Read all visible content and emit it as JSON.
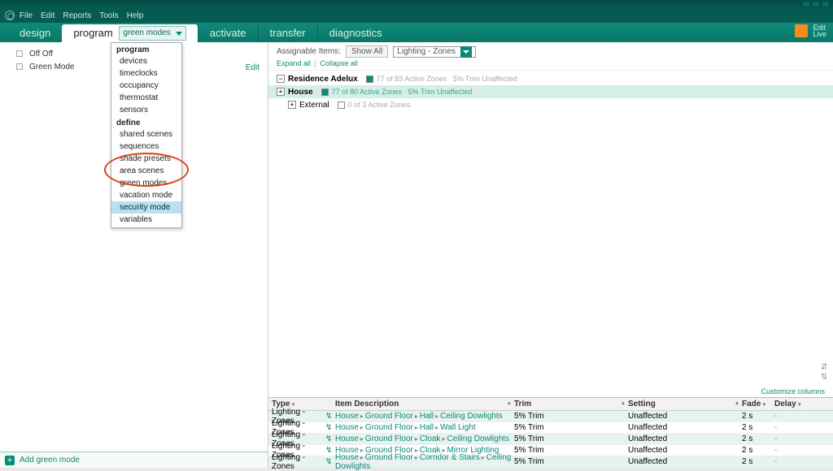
{
  "menubar": [
    "File",
    "Edit",
    "Reports",
    "Tools",
    "Help"
  ],
  "maintabs": {
    "design": "design",
    "program": "program",
    "activate": "activate",
    "transfer": "transfer",
    "diagnostics": "diagnostics"
  },
  "subcombo_label": "green modes",
  "right_header": {
    "edit": "Edit",
    "live": "Live"
  },
  "leftlist": {
    "row0": "Off  Off",
    "row1": "Green Mode",
    "edit": "Edit"
  },
  "leftfooter": {
    "add": "Add green mode"
  },
  "dropdown": {
    "grp_program": "program",
    "devices": "devices",
    "timeclocks": "timeclocks",
    "occupancy": "occupancy",
    "thermostat": "thermostat",
    "sensors": "sensors",
    "grp_define": "define",
    "shared_scenes": "shared scenes",
    "sequences": "sequences",
    "shade_presets": "shade presets",
    "area_scenes": "area scenes",
    "green_modes": "green modes",
    "vacation_mode": "vacation mode",
    "security_mode": "security mode",
    "variables": "variables"
  },
  "rp": {
    "assignable": "Assignable Items:",
    "showall": "Show All",
    "combo": "Lighting - Zones",
    "expand": "Expand all",
    "collapse": "Collapse all",
    "residence": "Residence Adelux",
    "res_stat": "77 of 83 Active Zones   5% Trim  Unaffected",
    "house": "House",
    "house_stat": "77 of 80 Active Zones   5% Trim  Unaffected",
    "external": "External",
    "ext_stat": "0 of 3 Active Zones",
    "customize": "Customize columns"
  },
  "grid": {
    "h_type": "Type",
    "h_desc": "Item Description",
    "h_trim": "Trim",
    "h_setting": "Setting",
    "h_fade": "Fade",
    "h_delay": "Delay",
    "rows": [
      {
        "type": "Lighting - Zones",
        "p1": "House",
        "p2": "Ground Floor",
        "p3": "Hall",
        "p4": "Ceiling Dowlights",
        "trim": "5% Trim",
        "set": "Unaffected",
        "fade": "2 s",
        "delay": "-"
      },
      {
        "type": "Lighting - Zones",
        "p1": "House",
        "p2": "Ground Floor",
        "p3": "Hall",
        "p4": "Wall Light",
        "trim": "5% Trim",
        "set": "Unaffected",
        "fade": "2 s",
        "delay": "-"
      },
      {
        "type": "Lighting - Zones",
        "p1": "House",
        "p2": "Ground Floor",
        "p3": "Cloak",
        "p4": "Ceiling Dowlights",
        "trim": "5% Trim",
        "set": "Unaffected",
        "fade": "2 s",
        "delay": "-"
      },
      {
        "type": "Lighting - Zones",
        "p1": "House",
        "p2": "Ground Floor",
        "p3": "Cloak",
        "p4": "Mirror Lighting",
        "trim": "5% Trim",
        "set": "Unaffected",
        "fade": "2 s",
        "delay": "-"
      },
      {
        "type": "Lighting - Zones",
        "p1": "House",
        "p2": "Ground Floor",
        "p3": "Corridor & Stairs",
        "p4": "Ceiling Dowlights",
        "trim": "5% Trim",
        "set": "Unaffected",
        "fade": "2 s",
        "delay": "-"
      }
    ]
  }
}
